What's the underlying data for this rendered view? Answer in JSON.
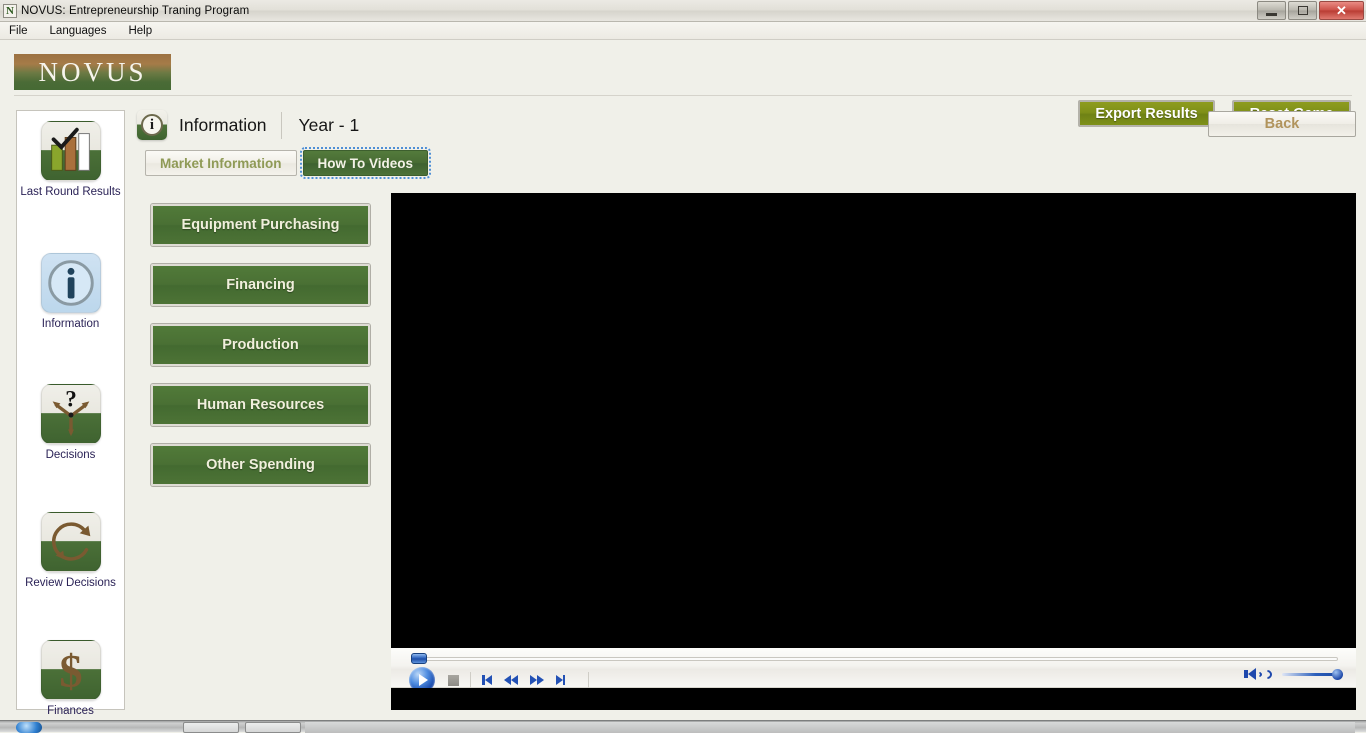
{
  "window": {
    "title": "NOVUS: Entrepreneurship Traning Program",
    "app_icon": "N",
    "minimize_icon": "minimize-icon",
    "maximize_icon": "maximize-icon",
    "close_label": "✕"
  },
  "menubar": {
    "items": [
      {
        "label": "File"
      },
      {
        "label": "Languages"
      },
      {
        "label": "Help"
      }
    ]
  },
  "brand": {
    "logo_text": "NOVUS",
    "export_label": "Export Results",
    "reset_label": "Reset Game",
    "logo_top_color": "#9c7242",
    "logo_bottom_color": "#466a34",
    "button_color": "#7f9019"
  },
  "sidebar": {
    "items": [
      {
        "label": "Last Round Results",
        "icon": "bar-chart-check-icon"
      },
      {
        "label": "Information",
        "icon": "info-circle-icon"
      },
      {
        "label": "Decisions",
        "icon": "question-arrows-icon"
      },
      {
        "label": "Review Decisions",
        "icon": "circular-arrow-icon"
      },
      {
        "label": "Finances",
        "icon": "dollar-sign-icon"
      }
    ]
  },
  "header": {
    "icon": "info-circle-icon",
    "title": "Information",
    "year": "Year - 1",
    "back_label": "Back"
  },
  "tabs": [
    {
      "label": "Market Information",
      "active": false
    },
    {
      "label": "How To Videos",
      "active": true
    }
  ],
  "nav_buttons": [
    {
      "label": "Equipment Purchasing"
    },
    {
      "label": "Financing"
    },
    {
      "label": "Production"
    },
    {
      "label": "Human Resources"
    },
    {
      "label": "Other Spending"
    }
  ],
  "player": {
    "screen_color": "#000000",
    "seek_position_percent": 0,
    "volume_percent": 100,
    "controls": [
      {
        "name": "play-button",
        "icon": "play-icon"
      },
      {
        "name": "stop-button",
        "icon": "stop-icon"
      },
      {
        "name": "previous-button",
        "icon": "skip-previous-icon"
      },
      {
        "name": "rewind-button",
        "icon": "rewind-icon"
      },
      {
        "name": "fast-forward-button",
        "icon": "fast-forward-icon"
      },
      {
        "name": "next-button",
        "icon": "skip-next-icon"
      }
    ],
    "volume_icon": "volume-icon"
  }
}
